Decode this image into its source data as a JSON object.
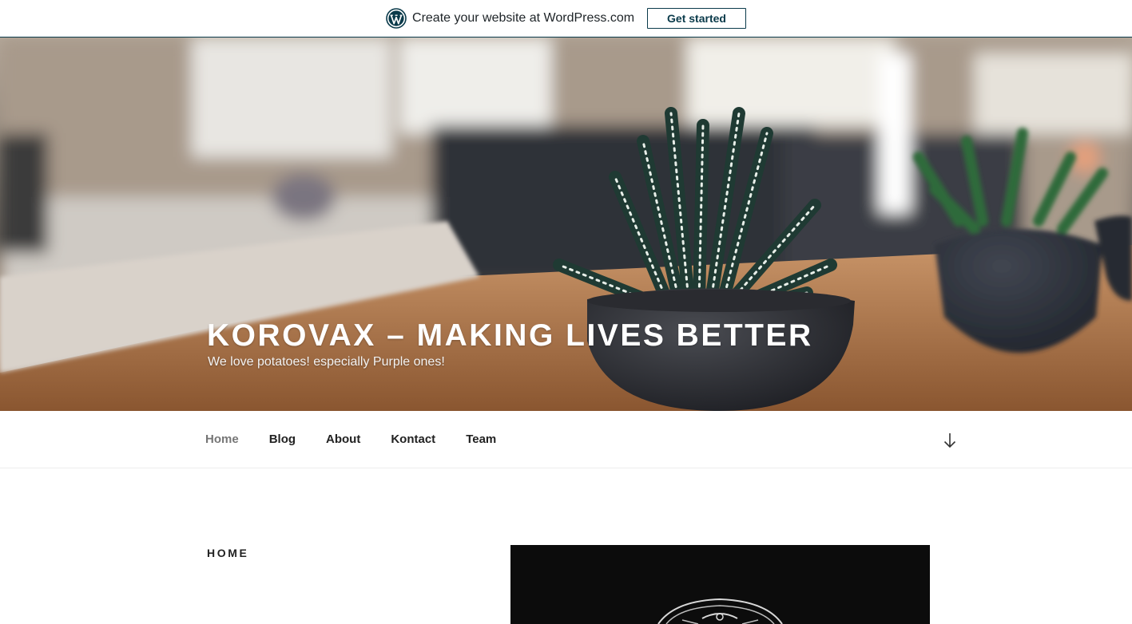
{
  "promo": {
    "text": "Create your website at WordPress.com",
    "button_label": "Get started",
    "logo_icon": "wordpress-logo-icon",
    "accent_color": "#0a3a4a"
  },
  "hero": {
    "site_title": "KOROVAX – MAKING LIVES BETTER",
    "tagline": "We love potatoes! especially Purple ones!"
  },
  "nav": {
    "items": [
      {
        "label": "Home",
        "current": true
      },
      {
        "label": "Blog",
        "current": false
      },
      {
        "label": "About",
        "current": false
      },
      {
        "label": "Kontact",
        "current": false
      },
      {
        "label": "Team",
        "current": false
      }
    ],
    "scroll_icon": "arrow-down-icon"
  },
  "content": {
    "section_title": "HOME"
  }
}
